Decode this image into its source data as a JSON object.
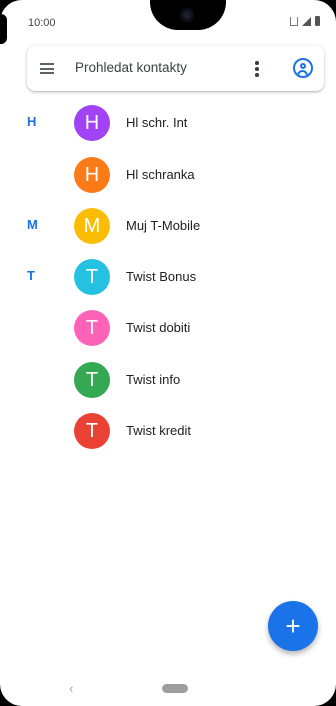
{
  "status_bar": {
    "time": "10:00",
    "icons": [
      "vibrate-icon",
      "signal-icon",
      "battery-icon"
    ]
  },
  "search": {
    "placeholder": "Prohledat kontakty",
    "menu_icon": "menu-icon",
    "more_icon": "more-vert-icon",
    "account_icon": "account-circle-icon"
  },
  "contacts": [
    {
      "section": "H",
      "initial": "H",
      "name": "Hl schr. Int",
      "color": "#a142f4"
    },
    {
      "section": "",
      "initial": "H",
      "name": "Hl schranka",
      "color": "#fa7b17"
    },
    {
      "section": "M",
      "initial": "M",
      "name": "Muj T-Mobile",
      "color": "#fbbc04"
    },
    {
      "section": "T",
      "initial": "T",
      "name": "Twist Bonus",
      "color": "#24c1e0"
    },
    {
      "section": "",
      "initial": "T",
      "name": "Twist dobiti",
      "color": "#ff63b8"
    },
    {
      "section": "",
      "initial": "T",
      "name": "Twist info",
      "color": "#34a853"
    },
    {
      "section": "",
      "initial": "T",
      "name": "Twist kredit",
      "color": "#e94235"
    }
  ],
  "fab": {
    "symbol": "+",
    "icon": "add-icon",
    "color": "#1a73e8"
  },
  "nav": {
    "back_symbol": "‹",
    "icons": [
      "back-icon",
      "home-pill-icon"
    ]
  },
  "colors": {
    "accent": "#1a73e8",
    "section_letter": "#1a73e8"
  }
}
